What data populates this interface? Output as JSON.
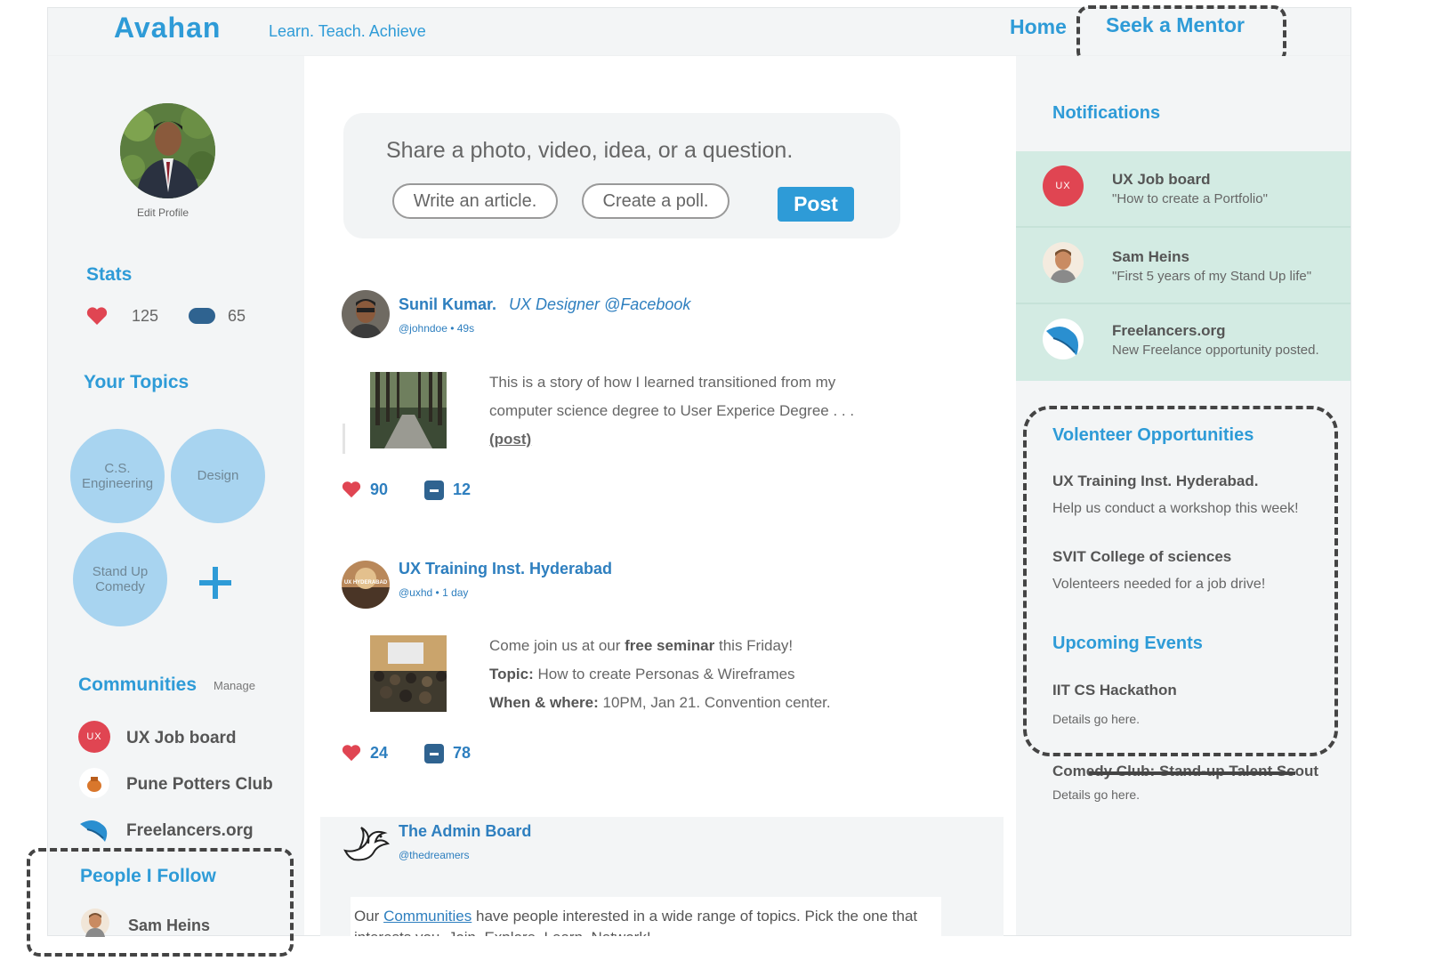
{
  "app": {
    "logo": "Avahan",
    "tagline": "Learn. Teach. Achieve",
    "nav": {
      "home": "Home",
      "seek_mentor": "Seek a Mentor"
    }
  },
  "colors": {
    "accent": "#2e9bd7",
    "notification_bg": "#d3ebe3",
    "topic_bubble": "#a8d4f0",
    "like_red": "#e04552"
  },
  "profile": {
    "edit_label": "Edit Profile",
    "stats_title": "Stats",
    "likes": "125",
    "comments": "65"
  },
  "topics": {
    "title": "Your Topics",
    "items": [
      "C.S. Engineering",
      "Design",
      "Stand Up Comedy"
    ],
    "add_icon": "plus-icon"
  },
  "communities": {
    "title": "Communities",
    "manage": "Manage",
    "items": [
      {
        "name": "UX Job board",
        "badge": "UX"
      },
      {
        "name": "Pune Potters Club"
      },
      {
        "name": "Freelancers.org"
      }
    ]
  },
  "people": {
    "title": "People I Follow",
    "items": [
      {
        "name": "Sam Heins"
      }
    ]
  },
  "composer": {
    "prompt": "Share a photo, video, idea, or a question.",
    "write_article": "Write an article.",
    "create_poll": "Create a poll.",
    "post": "Post"
  },
  "posts": [
    {
      "author": "Sunil Kumar.",
      "role": "UX Designer @Facebook",
      "meta": "@johndoe • 49s",
      "line1": "This is a story of how I learned transitioned from my",
      "line2": "computer science degree to User Experice Degree . . .",
      "link": "(post)",
      "likes": "90",
      "comments": "12"
    },
    {
      "author": "UX Training Inst. Hyderabad",
      "meta": "@uxhd • 1 day",
      "avatar_label": "UX HYDERABAD",
      "l1_a": "Come join us at our ",
      "l1_b": "free seminar",
      "l1_c": " this Friday!",
      "l2_a": "Topic:",
      "l2_b": " How to create Personas & Wireframes",
      "l3_a": "When & where:",
      "l3_b": " 10PM, Jan 21. Convention center.",
      "likes": "24",
      "comments": "78"
    },
    {
      "author": "The Admin Board",
      "meta": "@thedreamers",
      "text_a": "Our ",
      "text_link": "Communities",
      "text_b": " have  people interested in a wide range of topics. Pick the one that interests you. Join. Explore. Learn. Network!"
    }
  ],
  "notifications": {
    "title": "Notifications",
    "items": [
      {
        "title": "UX Job board",
        "sub": "\"How to create a Portfolio\"",
        "badge": "UX"
      },
      {
        "title": "Sam Heins",
        "sub": "\"First 5 years of my Stand Up life\""
      },
      {
        "title": "Freelancers.org",
        "sub": "New Freelance opportunity posted."
      }
    ]
  },
  "volunteer": {
    "title": "Volenteer Opportunities",
    "items": [
      {
        "title": "UX Training Inst. Hyderabad.",
        "sub": "Help us conduct a workshop this week!"
      },
      {
        "title": "SVIT College of sciences",
        "sub": "Volenteers needed for a job drive!"
      }
    ]
  },
  "events": {
    "title": "Upcoming Events",
    "items": [
      {
        "title": "IIT CS Hackathon",
        "sub": "Details go here."
      },
      {
        "title": "Comedy Club: Stand-up Talent Scout",
        "sub": "Details go here."
      }
    ]
  }
}
